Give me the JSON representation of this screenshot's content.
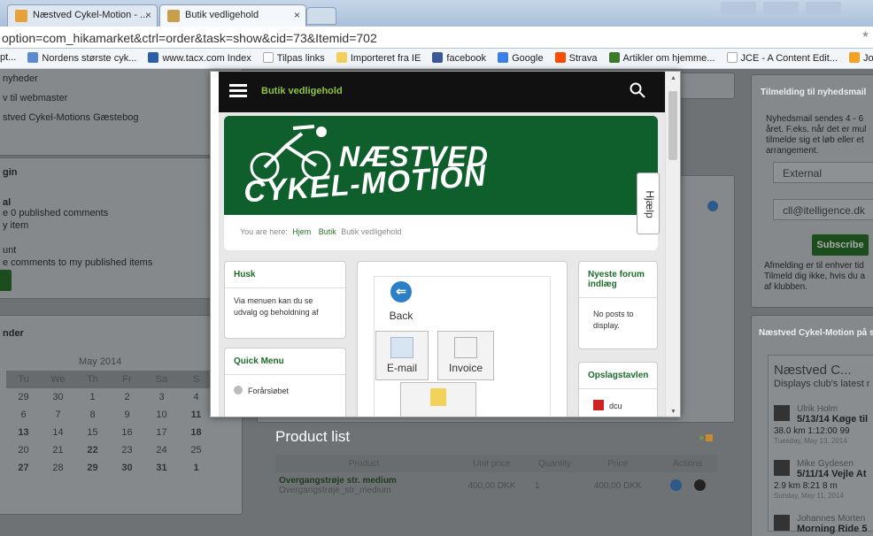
{
  "browser": {
    "tabs": [
      {
        "label": "Næstved Cykel-Motion - ...",
        "close": "×"
      },
      {
        "label": "Butik vedligehold",
        "close": "×"
      }
    ],
    "url": "option=com_hikamarket&ctrl=order&task=show&cid=73&Itemid=702",
    "bookmarks": [
      "pt...",
      "Nordens største cyk...",
      "www.tacx.com Index",
      "Tilpas links",
      "Importeret fra IE",
      "facebook",
      "Google",
      "Strava",
      "Artikler om hjemme...",
      "JCE - A Content Edit...",
      "Joomla Hosti"
    ]
  },
  "left": {
    "menu": [
      "nyheder",
      "v til webmaster",
      "stved Cykel-Motions Gæstebog"
    ],
    "login_title": "gin",
    "login_lines": [
      "al",
      "e 0 published comments",
      "y item",
      "unt",
      "e comments to my published items"
    ],
    "cal_title": "nder",
    "cal_month": "May 2014",
    "cal_days": [
      "Tu",
      "We",
      "Th",
      "Fr",
      "Sa",
      "S"
    ],
    "cal_rows": [
      [
        "29",
        "30",
        "1",
        "2",
        "3",
        "4"
      ],
      [
        "6",
        "7",
        "8",
        "9",
        "10",
        "11"
      ],
      [
        "13",
        "14",
        "15",
        "16",
        "17",
        "18"
      ],
      [
        "20",
        "21",
        "22",
        "23",
        "24",
        "25"
      ],
      [
        "27",
        "28",
        "29",
        "30",
        "31",
        "1"
      ]
    ]
  },
  "right": {
    "newsletter_title": "Tilmelding til nyhedsmail",
    "newsletter_text": [
      "Nyhedsmail sendes 4 - 6",
      "året. F.eks. når det er mul",
      "tilmelde sig et løb eller et",
      "arrangement."
    ],
    "select_value": "External",
    "email_value": "cll@itelligence.dk",
    "subscribe": "Subscribe",
    "unsub_text": [
      "Afmelding er til enhver tid",
      "Tilmeld dig ikke, hvis du a",
      "af klubben."
    ],
    "strava_title": "Næstved Cykel-Motion på strava",
    "strava_club": "Næstved C...",
    "strava_sub": "Displays club's latest r",
    "strava_items": [
      {
        "name": "Ulrik Holm",
        "title": "5/13/14 Køge til",
        "stats": "38.0 km  1:12:00  99",
        "date": "Tuesday, May 13, 2014"
      },
      {
        "name": "Mike Gydesen",
        "title": "5/11/14 Vejle At",
        "stats": "2.9 km  8:21  8 m",
        "date": "Sunday, May 11, 2014"
      },
      {
        "name": "Johannes Morten",
        "title": "Morning Ride 5",
        "stats": "",
        "date": ""
      }
    ]
  },
  "modal": {
    "title": "Butik vedligehold",
    "logo_line1": "NÆSTVED",
    "logo_line2": "CYKEL-MOTION",
    "crumb_prefix": "You are here:",
    "crumb_home": "Hjem",
    "crumb_shop": "Butik",
    "crumb_current": "Butik vedligehold",
    "help": "Hjælp",
    "husk_title": "Husk",
    "husk_text": "Via menuen kan du se udvalg og beholdning af",
    "quickmenu_title": "Quick Menu",
    "quickmenu_item": "Forårsløbet",
    "back": "Back",
    "email": "E-mail",
    "invoice": "Invoice",
    "forum_title": "Nyeste forum indlæg",
    "forum_text": "No posts to display.",
    "board_title": "Opslagstavlen",
    "board_item": "dcu"
  },
  "products": {
    "title": "Product list",
    "headers": [
      "Product",
      "Unit price",
      "Quantity",
      "Price",
      "Actions"
    ],
    "rows": [
      {
        "name": "Overgangstrøje str. medium",
        "code": "Overgangstrøje_str_medium",
        "unit": "400,00 DKK",
        "qty": "1",
        "price": "400,00 DKK"
      }
    ]
  }
}
